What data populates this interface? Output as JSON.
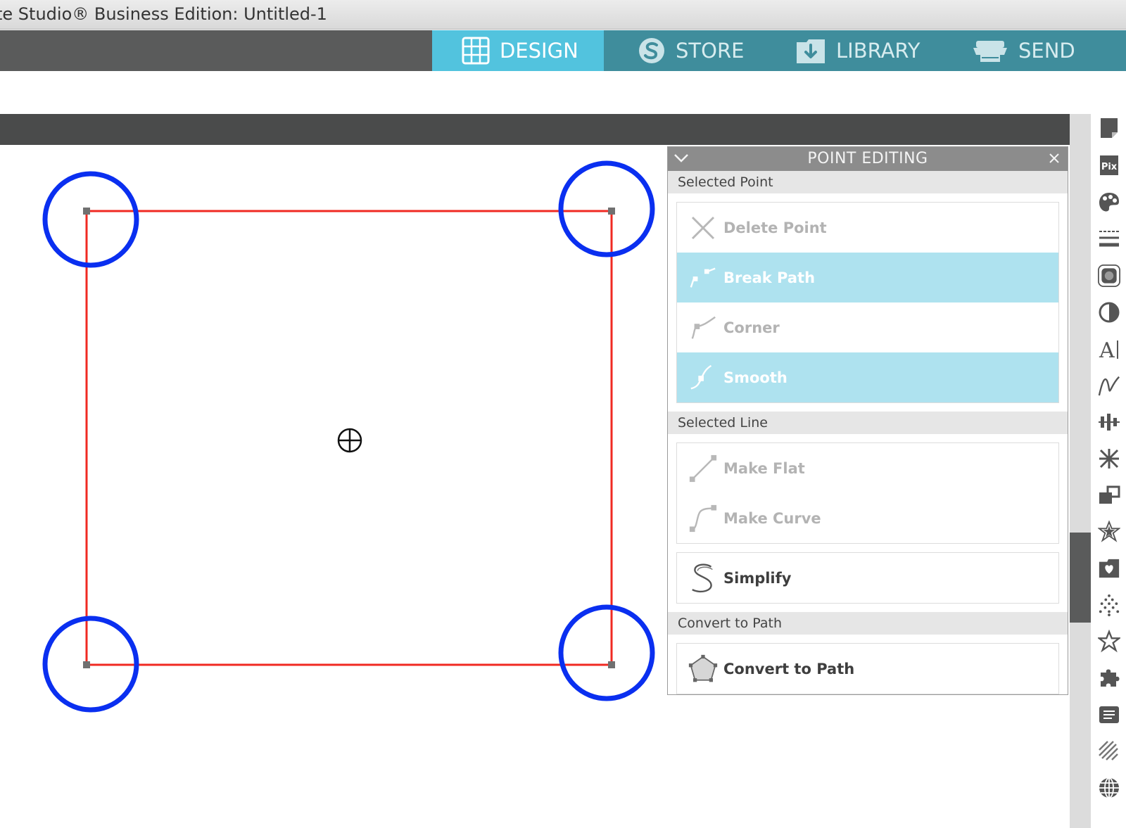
{
  "window": {
    "title": "te Studio® Business Edition: Untitled-1"
  },
  "nav": {
    "tabs": [
      {
        "label": "DESIGN",
        "icon": "grid-icon",
        "active": true
      },
      {
        "label": "STORE",
        "icon": "store-s-icon",
        "active": false
      },
      {
        "label": "LIBRARY",
        "icon": "library-download-icon",
        "active": false
      },
      {
        "label": "SEND",
        "icon": "cutter-machine-icon",
        "active": false
      }
    ]
  },
  "panel": {
    "title": "POINT EDITING",
    "sections": {
      "selected_point": "Selected Point",
      "selected_line": "Selected Line",
      "convert": "Convert to Path"
    },
    "buttons": {
      "delete_point": "Delete Point",
      "break_path": "Break Path",
      "corner": "Corner",
      "smooth": "Smooth",
      "make_flat": "Make Flat",
      "make_curve": "Make Curve",
      "simplify": "Simplify",
      "convert_to_path": "Convert to Path"
    },
    "states": {
      "delete_point": "disabled",
      "break_path": "highlighted",
      "corner": "disabled",
      "smooth": "highlighted",
      "make_flat": "disabled",
      "make_curve": "disabled",
      "simplify": "enabled",
      "convert_to_path": "enabled"
    }
  },
  "canvas": {
    "shape": "rectangle",
    "stroke_color": "#f02a22",
    "highlight_color": "#0a2ff0",
    "highlighted_points": 4
  },
  "rail_icons": [
    "page-setup-icon",
    "pixscan-icon",
    "fill-color-icon",
    "line-style-icon",
    "trace-icon",
    "image-effects-icon",
    "text-style-icon",
    "sketch-icon",
    "align-icon",
    "replicate-icon",
    "transform-icon",
    "offset-icon",
    "rhinestone-icon",
    "emboss-icon",
    "library-icon",
    "puzzle-icon",
    "layers-icon",
    "fill-pattern-icon",
    "globe-icon"
  ],
  "colors": {
    "nav_bg": "#5a5b5b",
    "tab_bg": "#3f8d9c",
    "tab_active": "#52c3de",
    "button_highlight": "#aee2ef"
  }
}
